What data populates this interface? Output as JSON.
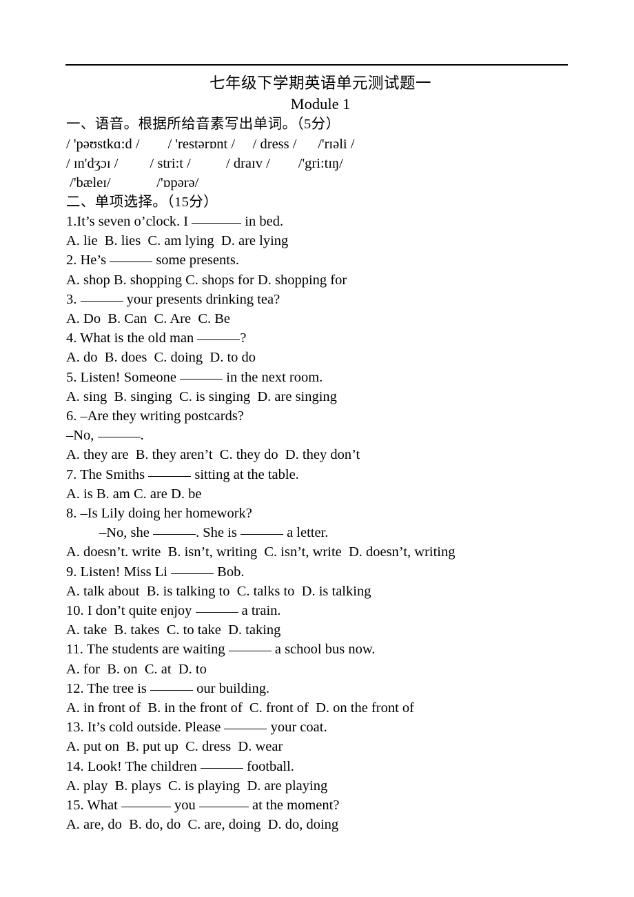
{
  "document": {
    "title_cn": "七年级下学期英语单元测试题一",
    "title_en": "Module 1"
  },
  "sections": [
    {
      "id": "phonetics",
      "heading": "一、语音。根据所给音素写出单词。（5分）",
      "score": "5分",
      "ipa_lines": [
        "/ 'pəʊstkɑ:d /        / 'restərɒnt /     / dress /      /'rɪəli /",
        "/ ɪn'dʒɔɪ /         / stri:t /          / draɪv /        /'gri:tɪŋ/",
        " /'bæleɪ/             /'ɒpərə/"
      ],
      "ipa_words": [
        "/ 'pəʊstkɑ:d /",
        "/ 'restərɒnt /",
        "/ dress /",
        "/'rɪəli /",
        "/ ɪn'dʒɔɪ /",
        "/ stri:t /",
        "/ draɪv /",
        "/'gri:tɪŋ/",
        "/'bæleɪ/",
        "/'ɒpərə/"
      ]
    },
    {
      "id": "multiple-choice",
      "heading": "二、单项选择。（15分）",
      "score": "15分"
    }
  ],
  "questions": [
    {
      "num": "1.",
      "stem_before": "It’s seven o’clock. I ",
      "stem_after": " in bed.",
      "options": "A. lie  B. lies  C. am lying  D. are lying"
    },
    {
      "num": "2.",
      "stem_before": "He’s ",
      "stem_after": " some presents.",
      "options": "A. shop B. shopping C. shops for D. shopping for"
    },
    {
      "num": "3.",
      "stem_before": "",
      "stem_after": " your presents drinking tea?",
      "options": "A. Do  B. Can  C. Are  C. Be"
    },
    {
      "num": "4.",
      "stem_before": "What is the old man ",
      "stem_after": "?",
      "options": "A. do  B. does  C. doing  D. to do"
    },
    {
      "num": "5.",
      "stem_before": "Listen! Someone ",
      "stem_after": " in the next room.",
      "options": "A. sing  B. singing  C. is singing  D. are singing"
    },
    {
      "num": "6.",
      "stem_before": "–Are they writing postcards?",
      "reply_before": "–No, ",
      "reply_after": ".",
      "options": "A. they are  B. they aren’t  C. they do  D. they don’t"
    },
    {
      "num": "7.",
      "stem_before": "The Smiths ",
      "stem_after": " sitting at the table.",
      "options": "A. is B. am C. are D. be"
    },
    {
      "num": "8.",
      "stem_before": "–Is Lily doing her homework?",
      "reply_before": "–No, she ",
      "reply_mid": ". She is ",
      "reply_after": " a letter.",
      "options": "A. doesn’t. write  B. isn’t, writing  C. isn’t, write  D. doesn’t, writing"
    },
    {
      "num": "9.",
      "stem_before": "Listen! Miss Li ",
      "stem_after": " Bob.",
      "options": "A. talk about  B. is talking to  C. talks to  D. is talking"
    },
    {
      "num": "10.",
      "stem_before": "I don’t quite enjoy ",
      "stem_after": " a train.",
      "options": "A. take  B. takes  C. to take  D. taking"
    },
    {
      "num": "11.",
      "stem_before": "The students are waiting ",
      "stem_after": " a school bus now.",
      "options": "A. for  B. on  C. at  D. to"
    },
    {
      "num": "12.",
      "stem_before": "The tree is ",
      "stem_after": " our building.",
      "options": "A. in front of  B. in the front of  C. front of  D. on the front of"
    },
    {
      "num": "13.",
      "stem_before": "It’s cold outside. Please ",
      "stem_after": " your coat.",
      "options": "A. put on  B. put up  C. dress  D. wear"
    },
    {
      "num": "14.",
      "stem_before": "Look! The children ",
      "stem_after": " football.",
      "options": "A. play  B. plays  C. is playing  D. are playing"
    },
    {
      "num": "15.",
      "stem_before": "What ",
      "stem_mid": " you ",
      "stem_after": " at the moment?",
      "options": "A. are, do  B. do, do  C. are, doing  D. do, doing"
    }
  ]
}
